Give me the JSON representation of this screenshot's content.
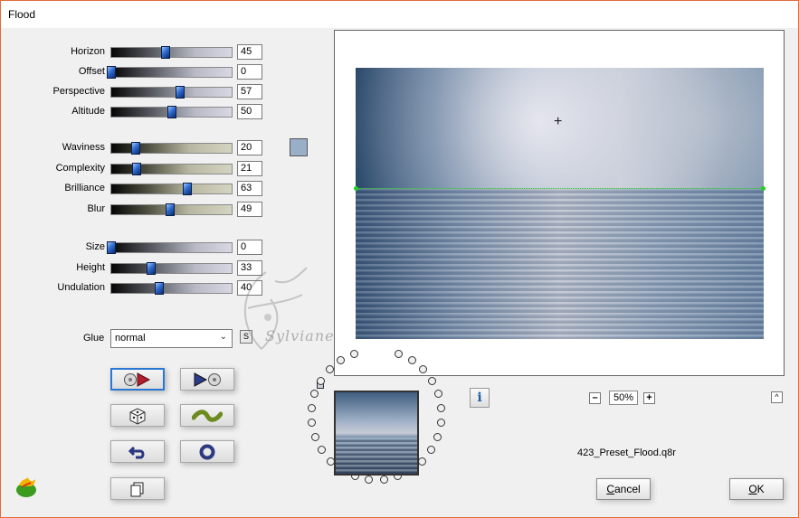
{
  "window": {
    "title": "Flood"
  },
  "sliders_group1": [
    {
      "label": "Horizon",
      "value": "45",
      "pos": 0.45,
      "style": "grey"
    },
    {
      "label": "Offset",
      "value": "0",
      "pos": 0.0,
      "style": "grey"
    },
    {
      "label": "Perspective",
      "value": "57",
      "pos": 0.57,
      "style": "grey"
    },
    {
      "label": "Altitude",
      "value": "50",
      "pos": 0.5,
      "style": "grey"
    }
  ],
  "sliders_group2": [
    {
      "label": "Waviness",
      "value": "20",
      "pos": 0.2,
      "style": "olive"
    },
    {
      "label": "Complexity",
      "value": "21",
      "pos": 0.21,
      "style": "olive"
    },
    {
      "label": "Brilliance",
      "value": "63",
      "pos": 0.63,
      "style": "olive"
    },
    {
      "label": "Blur",
      "value": "49",
      "pos": 0.49,
      "style": "olive"
    }
  ],
  "sliders_group3": [
    {
      "label": "Size",
      "value": "0",
      "pos": 0.0,
      "style": "grey"
    },
    {
      "label": "Height",
      "value": "33",
      "pos": 0.33,
      "style": "grey"
    },
    {
      "label": "Undulation",
      "value": "40",
      "pos": 0.4,
      "style": "grey"
    }
  ],
  "color_swatch": "#99afc8",
  "glue": {
    "label": "Glue",
    "value": "normal",
    "s_label": "S"
  },
  "watermark": "Sylviane",
  "zoom": {
    "value": "50%",
    "minus": "–",
    "plus": "+"
  },
  "info_label": "i",
  "up_label": "^",
  "preset_name": "423_Preset_Flood.q8r",
  "buttons": {
    "cancel_first": "C",
    "cancel_rest": "ancel",
    "ok_first": "O",
    "ok_rest": "K"
  }
}
